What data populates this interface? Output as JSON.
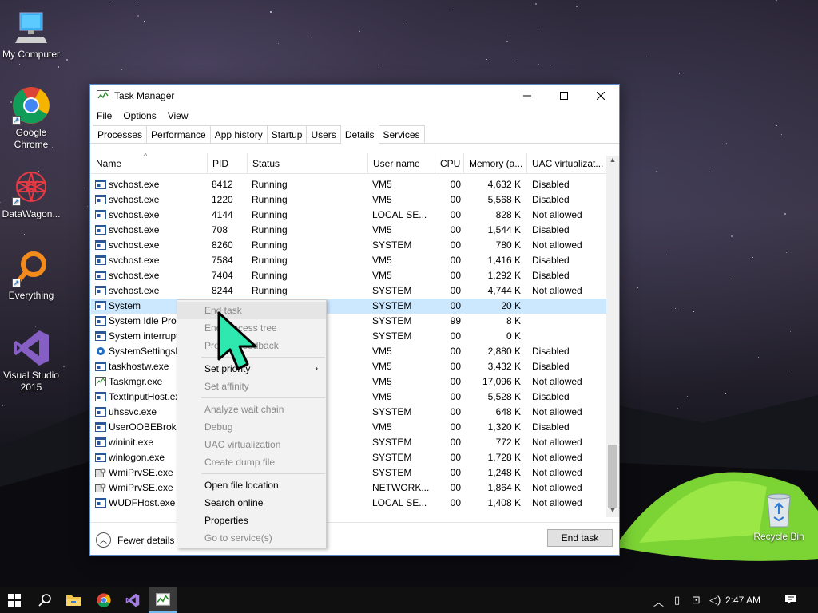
{
  "desktop": {
    "icons": [
      {
        "label": "My Computer",
        "icon": "computer-icon"
      },
      {
        "label": "Google Chrome",
        "icon": "chrome-icon"
      },
      {
        "label": "DataWagon...",
        "icon": "datawagon-icon"
      },
      {
        "label": "Everything",
        "icon": "everything-search-icon"
      },
      {
        "label": "Visual Studio 2015",
        "icon": "visual-studio-icon"
      },
      {
        "label": "Recycle Bin",
        "icon": "recycle-bin-icon"
      }
    ]
  },
  "window": {
    "title": "Task Manager",
    "menu": [
      "File",
      "Options",
      "View"
    ],
    "tabs": [
      "Processes",
      "Performance",
      "App history",
      "Startup",
      "Users",
      "Details",
      "Services"
    ],
    "active_tab": "Details",
    "columns": [
      "Name",
      "PID",
      "Status",
      "User name",
      "CPU",
      "Memory (a...",
      "UAC virtualizat..."
    ],
    "rows": [
      {
        "name": "svchost.exe",
        "pid": "8412",
        "status": "Running",
        "user": "VM5",
        "cpu": "00",
        "mem": "4,632 K",
        "uac": "Disabled",
        "icon": "service-host-icon"
      },
      {
        "name": "svchost.exe",
        "pid": "1220",
        "status": "Running",
        "user": "VM5",
        "cpu": "00",
        "mem": "5,568 K",
        "uac": "Disabled",
        "icon": "service-host-icon"
      },
      {
        "name": "svchost.exe",
        "pid": "4144",
        "status": "Running",
        "user": "LOCAL SE...",
        "cpu": "00",
        "mem": "828 K",
        "uac": "Not allowed",
        "icon": "service-host-icon"
      },
      {
        "name": "svchost.exe",
        "pid": "708",
        "status": "Running",
        "user": "VM5",
        "cpu": "00",
        "mem": "1,544 K",
        "uac": "Disabled",
        "icon": "service-host-icon"
      },
      {
        "name": "svchost.exe",
        "pid": "8260",
        "status": "Running",
        "user": "SYSTEM",
        "cpu": "00",
        "mem": "780 K",
        "uac": "Not allowed",
        "icon": "service-host-icon"
      },
      {
        "name": "svchost.exe",
        "pid": "7584",
        "status": "Running",
        "user": "VM5",
        "cpu": "00",
        "mem": "1,416 K",
        "uac": "Disabled",
        "icon": "service-host-icon"
      },
      {
        "name": "svchost.exe",
        "pid": "7404",
        "status": "Running",
        "user": "VM5",
        "cpu": "00",
        "mem": "1,292 K",
        "uac": "Disabled",
        "icon": "service-host-icon"
      },
      {
        "name": "svchost.exe",
        "pid": "8244",
        "status": "Running",
        "user": "SYSTEM",
        "cpu": "00",
        "mem": "4,744 K",
        "uac": "Not allowed",
        "icon": "service-host-icon"
      },
      {
        "name": "System",
        "pid": "",
        "status": "",
        "user": "SYSTEM",
        "cpu": "00",
        "mem": "20 K",
        "uac": "",
        "icon": "process-icon",
        "selected": true
      },
      {
        "name": "System Idle Proc",
        "pid": "",
        "status": "",
        "user": "SYSTEM",
        "cpu": "99",
        "mem": "8 K",
        "uac": "",
        "icon": "process-icon"
      },
      {
        "name": "System interrupt",
        "pid": "",
        "status": "",
        "user": "SYSTEM",
        "cpu": "00",
        "mem": "0 K",
        "uac": "",
        "icon": "process-icon"
      },
      {
        "name": "SystemSettingsB",
        "pid": "",
        "status": "",
        "user": "VM5",
        "cpu": "00",
        "mem": "2,880 K",
        "uac": "Disabled",
        "icon": "settings-gear-icon"
      },
      {
        "name": "taskhostw.exe",
        "pid": "",
        "status": "",
        "user": "VM5",
        "cpu": "00",
        "mem": "3,432 K",
        "uac": "Disabled",
        "icon": "process-icon"
      },
      {
        "name": "Taskmgr.exe",
        "pid": "",
        "status": "",
        "user": "VM5",
        "cpu": "00",
        "mem": "17,096 K",
        "uac": "Not allowed",
        "icon": "task-manager-icon"
      },
      {
        "name": "TextInputHost.ex",
        "pid": "",
        "status": "",
        "user": "VM5",
        "cpu": "00",
        "mem": "5,528 K",
        "uac": "Disabled",
        "icon": "process-icon"
      },
      {
        "name": "uhssvc.exe",
        "pid": "",
        "status": "",
        "user": "SYSTEM",
        "cpu": "00",
        "mem": "648 K",
        "uac": "Not allowed",
        "icon": "process-icon"
      },
      {
        "name": "UserOOBEBroker",
        "pid": "",
        "status": "",
        "user": "VM5",
        "cpu": "00",
        "mem": "1,320 K",
        "uac": "Disabled",
        "icon": "process-icon"
      },
      {
        "name": "wininit.exe",
        "pid": "",
        "status": "",
        "user": "SYSTEM",
        "cpu": "00",
        "mem": "772 K",
        "uac": "Not allowed",
        "icon": "process-icon"
      },
      {
        "name": "winlogon.exe",
        "pid": "",
        "status": "",
        "user": "SYSTEM",
        "cpu": "00",
        "mem": "1,728 K",
        "uac": "Not allowed",
        "icon": "process-icon"
      },
      {
        "name": "WmiPrvSE.exe",
        "pid": "",
        "status": "",
        "user": "SYSTEM",
        "cpu": "00",
        "mem": "1,248 K",
        "uac": "Not allowed",
        "icon": "wmi-icon"
      },
      {
        "name": "WmiPrvSE.exe",
        "pid": "",
        "status": "",
        "user": "NETWORK...",
        "cpu": "00",
        "mem": "1,864 K",
        "uac": "Not allowed",
        "icon": "wmi-icon"
      },
      {
        "name": "WUDFHost.exe",
        "pid": "",
        "status": "",
        "user": "LOCAL SE...",
        "cpu": "00",
        "mem": "1,408 K",
        "uac": "Not allowed",
        "icon": "process-icon"
      }
    ],
    "fewer_details": "Fewer details",
    "end_task_button": "End task"
  },
  "context_menu": [
    {
      "label": "End task",
      "disabled": true,
      "hover": true
    },
    {
      "label": "End process tree",
      "disabled": true
    },
    {
      "label": "Provide feedback",
      "disabled": true
    },
    {
      "sep": true
    },
    {
      "label": "Set priority",
      "disabled": false,
      "submenu": true
    },
    {
      "label": "Set affinity",
      "disabled": true
    },
    {
      "sep": true
    },
    {
      "label": "Analyze wait chain",
      "disabled": true
    },
    {
      "label": "Debug",
      "disabled": true
    },
    {
      "label": "UAC virtualization",
      "disabled": true
    },
    {
      "label": "Create dump file",
      "disabled": true
    },
    {
      "sep": true
    },
    {
      "label": "Open file location",
      "disabled": false
    },
    {
      "label": "Search online",
      "disabled": false
    },
    {
      "label": "Properties",
      "disabled": false
    },
    {
      "label": "Go to service(s)",
      "disabled": true
    }
  ],
  "taskbar": {
    "clock": "2:47 AM",
    "pinned": [
      "start-icon",
      "search-icon",
      "file-explorer-icon",
      "chrome-icon",
      "visual-studio-icon",
      "task-manager-icon"
    ],
    "active": "task-manager-icon"
  },
  "colors": {
    "selection": "#cce8ff",
    "accent": "#0078d7",
    "cursor": "#2ee8b0"
  }
}
